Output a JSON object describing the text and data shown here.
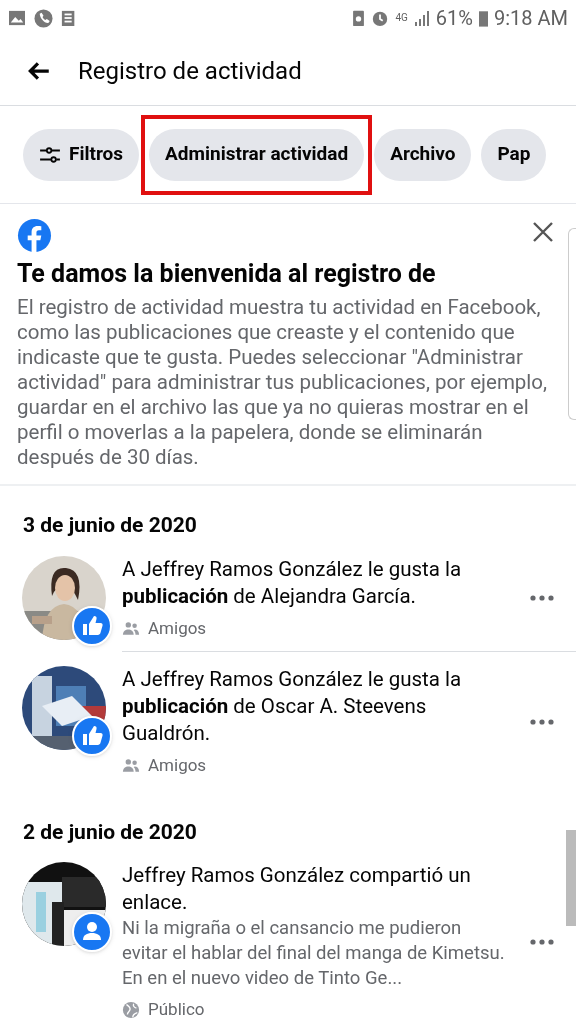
{
  "status_bar": {
    "network": "4G",
    "battery": "61%",
    "time": "9:18 AM"
  },
  "header": {
    "title": "Registro de actividad"
  },
  "chips": [
    {
      "label": "Filtros",
      "kind": "filter",
      "highlighted": false
    },
    {
      "label": "Administrar actividad",
      "kind": "plain",
      "highlighted": true
    },
    {
      "label": "Archivo",
      "kind": "plain",
      "highlighted": false
    },
    {
      "label": "Pap",
      "kind": "plain",
      "highlighted": false
    }
  ],
  "welcome": {
    "title": "Te damos la bienvenida al registro de",
    "body": "El registro de actividad muestra tu actividad en Facebook, como las publicaciones que creaste y el contenido que indicaste que te gusta. Puedes seleccionar \"Administrar actividad\" para administrar tus publicaciones, por ejemplo, guardar en el archivo las que ya no quieras mostrar en el perfil o moverlas a la papelera, donde se eliminarán después de 30 días."
  },
  "sections": [
    {
      "date": "3 de junio de 2020",
      "items": [
        {
          "kind": "like",
          "text": "A Jeffrey Ramos González le gusta la **publicación** de Alejandra García.",
          "audience": {
            "label": "Amigos",
            "kind": "friends"
          }
        },
        {
          "kind": "like",
          "text": "A Jeffrey Ramos González le gusta la **publicación** de Oscar A. Steevens Gualdrón.",
          "audience": {
            "label": "Amigos",
            "kind": "friends"
          }
        }
      ]
    },
    {
      "date": "2 de junio de 2020",
      "items": [
        {
          "kind": "share",
          "text": "Jeffrey Ramos González compartió un enlace.",
          "preview": "Ni la migraña o el cansancio me pudieron evitar el hablar del final del manga de Kimetsu. En en el nuevo video de Tinto Ge...",
          "audience": {
            "label": "Público",
            "kind": "public"
          }
        }
      ]
    }
  ]
}
